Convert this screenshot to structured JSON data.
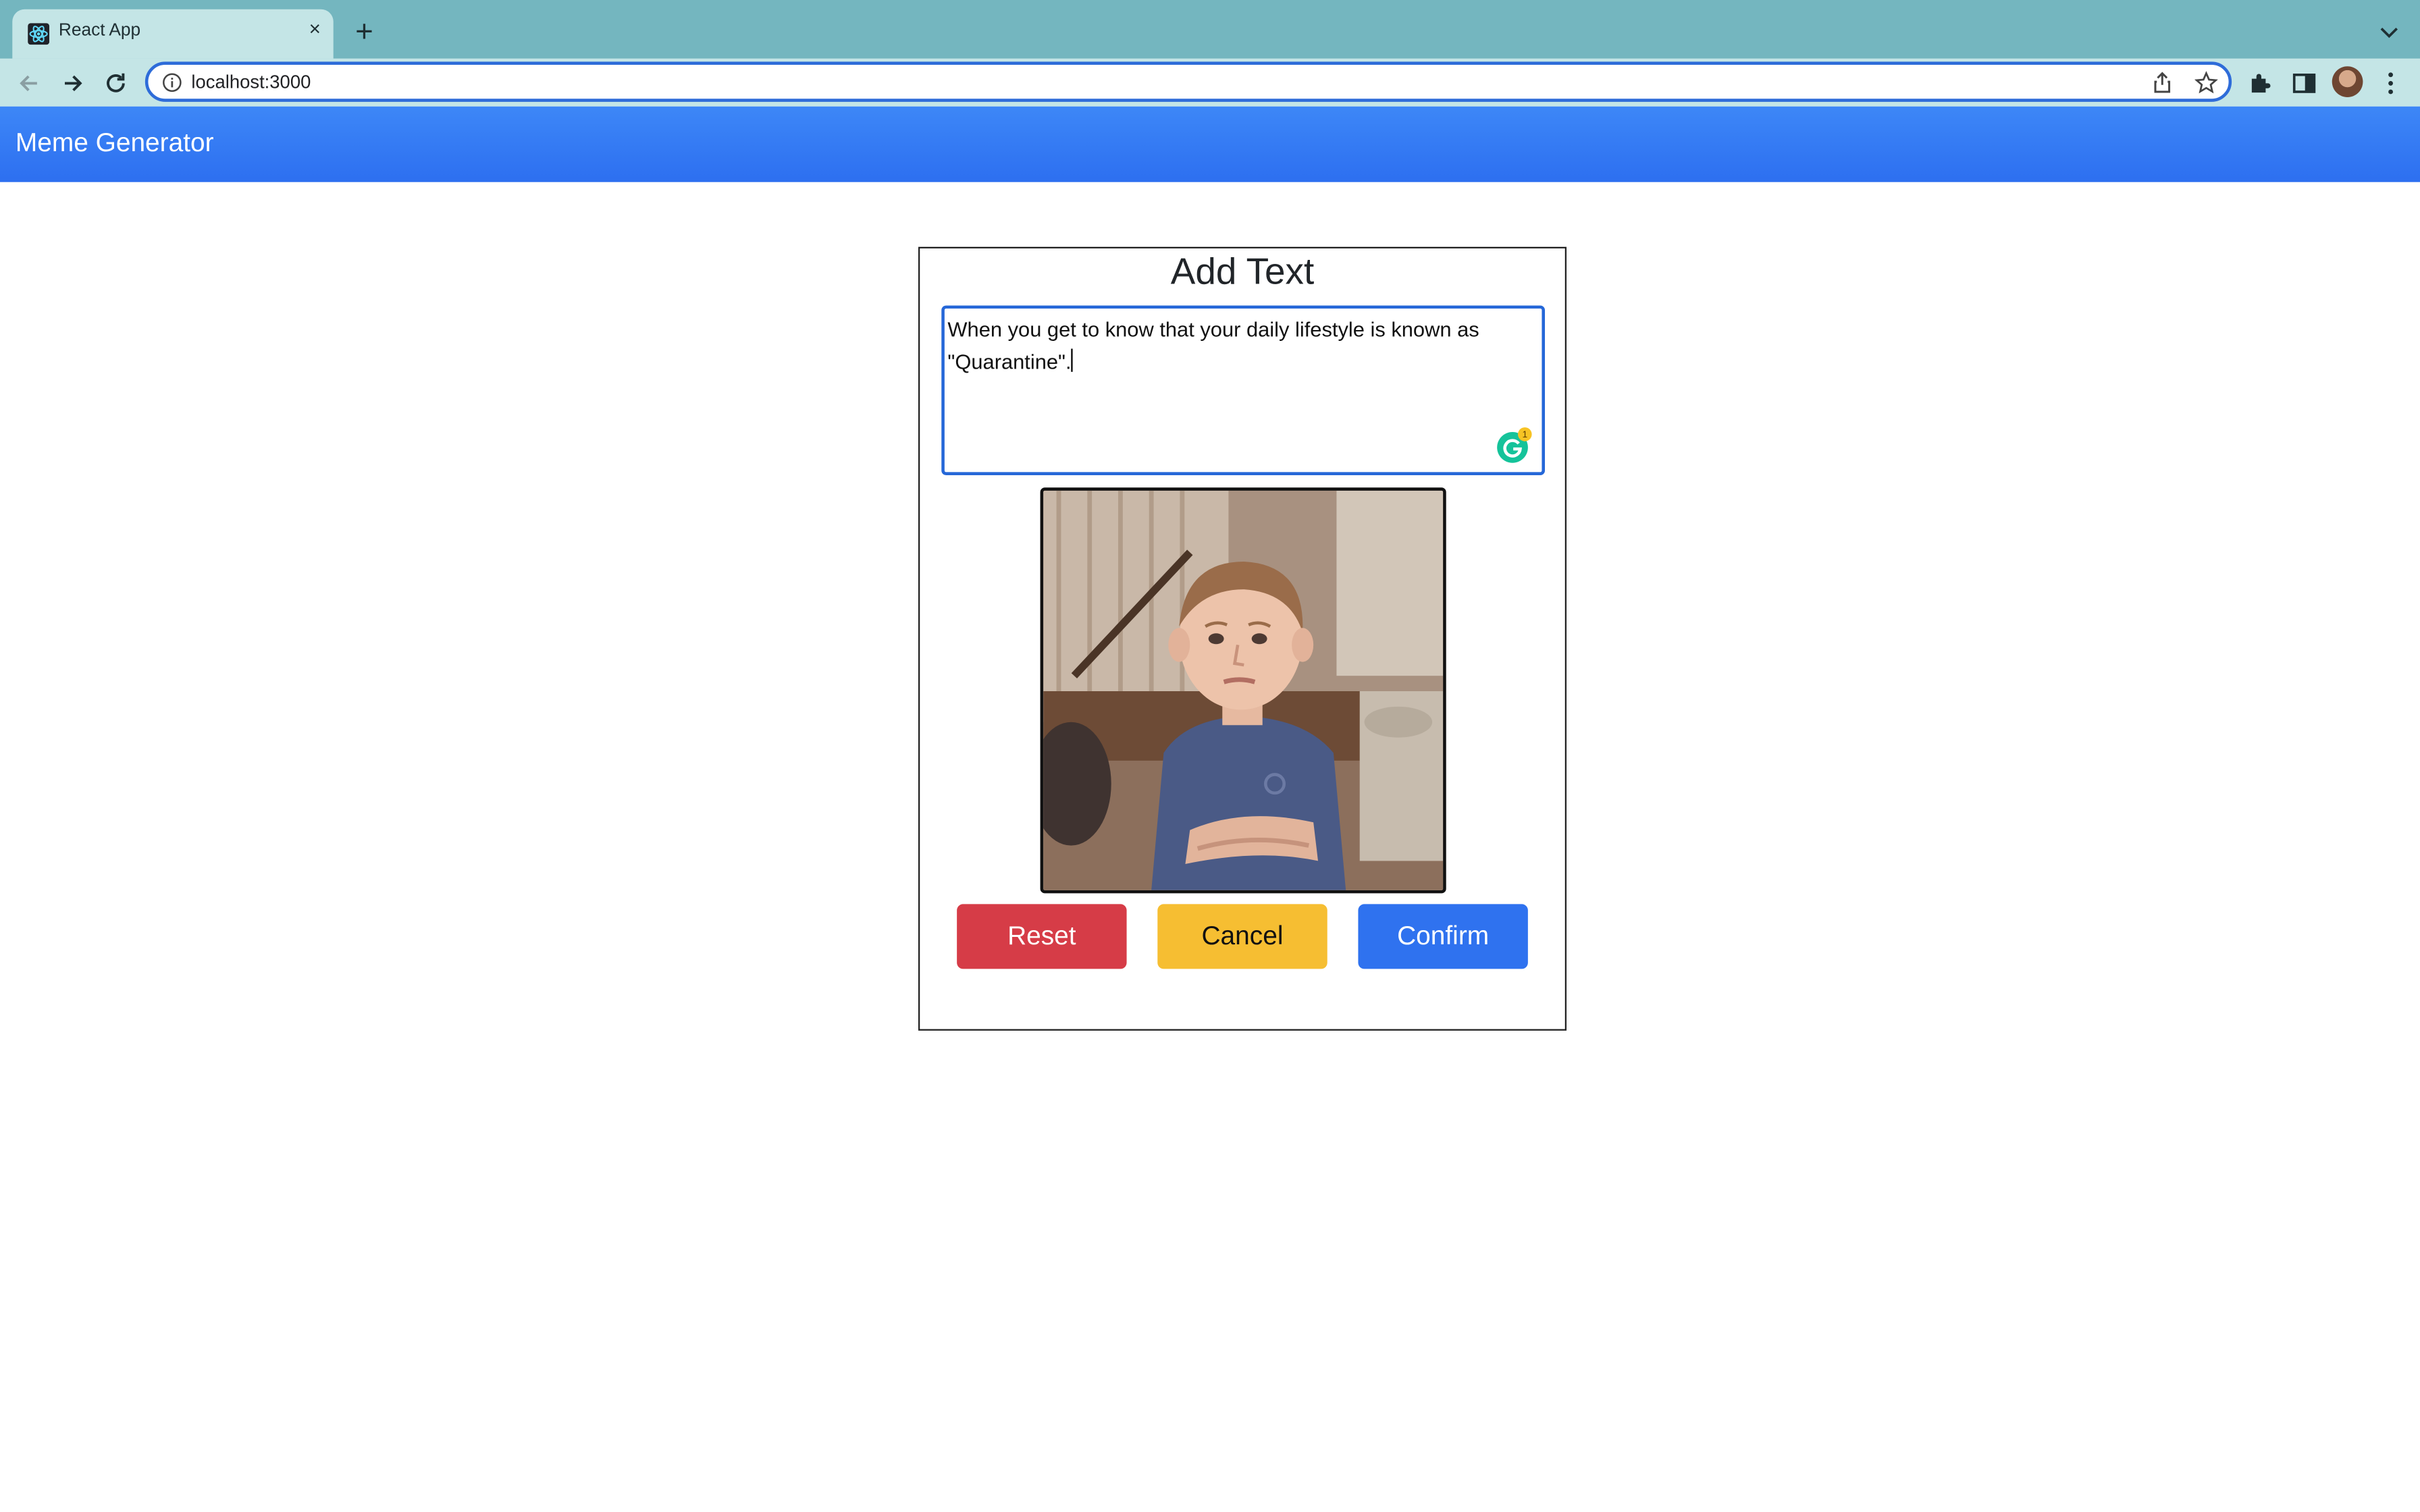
{
  "browser": {
    "tab": {
      "title": "React App",
      "favicon": "react-icon",
      "close": "×"
    },
    "new_tab": "+",
    "url": "localhost:3000"
  },
  "navbar": {
    "brand": "Meme Generator",
    "color": "#2f72ef"
  },
  "editor": {
    "title": "Add Text",
    "text_value": "When you get to know that your daily lifestyle is known as \"Quarantine\".",
    "grammarly_badge": "1",
    "image": "child-arms-crossed-meme",
    "buttons": {
      "reset": "Reset",
      "cancel": "Cancel",
      "confirm": "Confirm"
    }
  },
  "colors": {
    "reset": "#d63c47",
    "cancel": "#f6be32",
    "confirm": "#2f72ef",
    "tabstrip": "#74b6bf"
  }
}
